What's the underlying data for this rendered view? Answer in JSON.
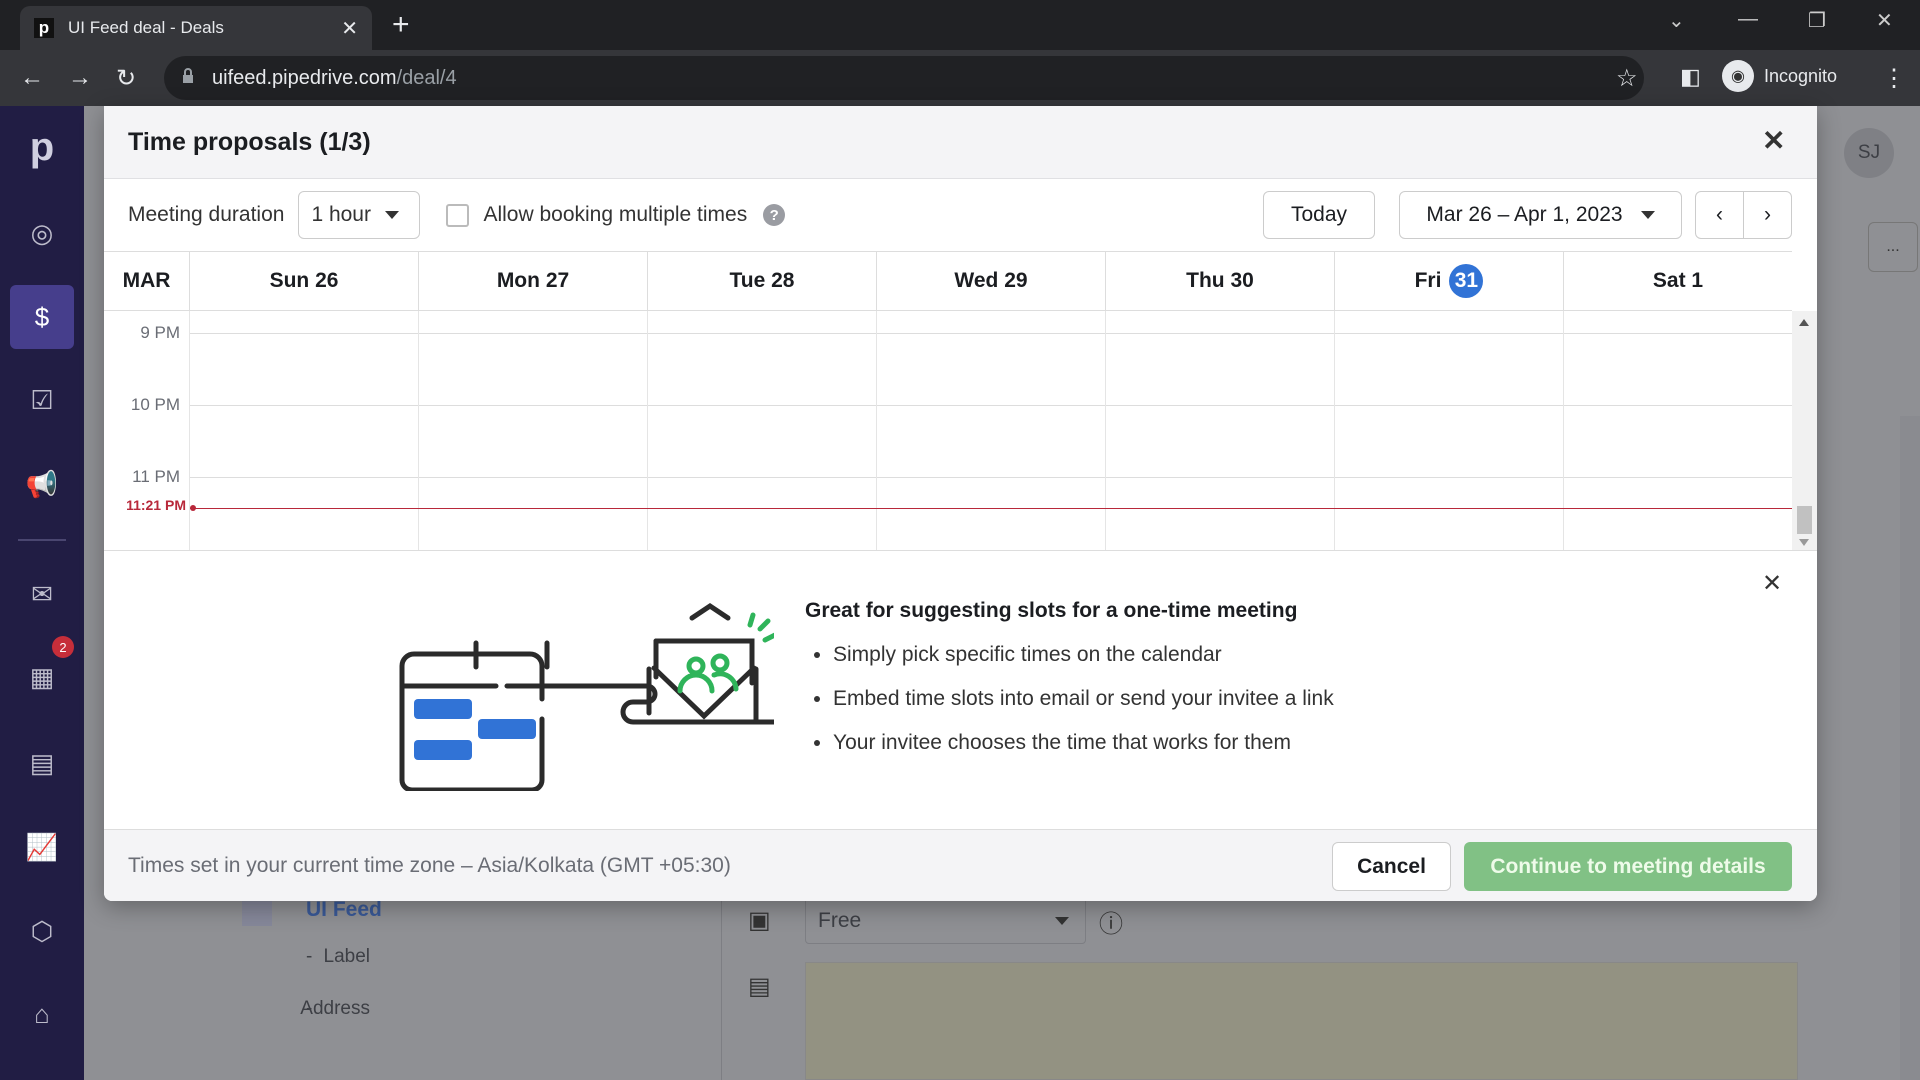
{
  "browser": {
    "tab_title": "UI Feed deal - Deals",
    "favicon": "p",
    "url_host": "uifeed.pipedrive.com",
    "url_path": "/deal/4",
    "profile": "Incognito"
  },
  "sidebar": {
    "items": [
      {
        "icon": "target-icon"
      },
      {
        "icon": "dollar-icon",
        "active": true
      },
      {
        "icon": "tasks-icon"
      },
      {
        "icon": "megaphone-icon"
      },
      {
        "icon": "mail-icon"
      },
      {
        "icon": "calendar-icon",
        "badge": "2"
      },
      {
        "icon": "contacts-icon"
      },
      {
        "icon": "chart-icon"
      },
      {
        "icon": "box-icon"
      },
      {
        "icon": "store-icon"
      }
    ]
  },
  "background": {
    "avatar": "SJ",
    "org_name": "UI Feed",
    "label_key": "Label",
    "label_value": "-",
    "address_key": "Address",
    "address_value": "-",
    "availability": "Free",
    "more": "..."
  },
  "modal": {
    "title": "Time proposals (1/3)",
    "duration_label": "Meeting duration",
    "duration_value": "1 hour",
    "multi_label": "Allow booking multiple times",
    "multi_checked": false,
    "today_label": "Today",
    "date_range": "Mar 26 – Apr 1, 2023",
    "month": "MAR",
    "days": [
      {
        "name": "Sun",
        "num": "26"
      },
      {
        "name": "Mon",
        "num": "27"
      },
      {
        "name": "Tue",
        "num": "28"
      },
      {
        "name": "Wed",
        "num": "29"
      },
      {
        "name": "Thu",
        "num": "30"
      },
      {
        "name": "Fri",
        "num": "31",
        "today": true
      },
      {
        "name": "Sat",
        "num": "1"
      }
    ],
    "times": [
      "9 PM",
      "10 PM",
      "11 PM"
    ],
    "now_time": "11:21 PM",
    "info_title": "Great for suggesting slots for a one-time meeting",
    "info_bullets": [
      "Simply pick specific times on the calendar",
      "Embed time slots into email or send your invitee a link",
      "Your invitee chooses the time that works for them"
    ],
    "timezone_note": "Times set in your current time zone – Asia/Kolkata (GMT +05:30)",
    "cancel_label": "Cancel",
    "continue_label": "Continue to meeting details"
  },
  "colors": {
    "accent": "#3173d6",
    "now_line": "#b8283a",
    "continue": "#81c185",
    "sidebar": "#211d44"
  }
}
